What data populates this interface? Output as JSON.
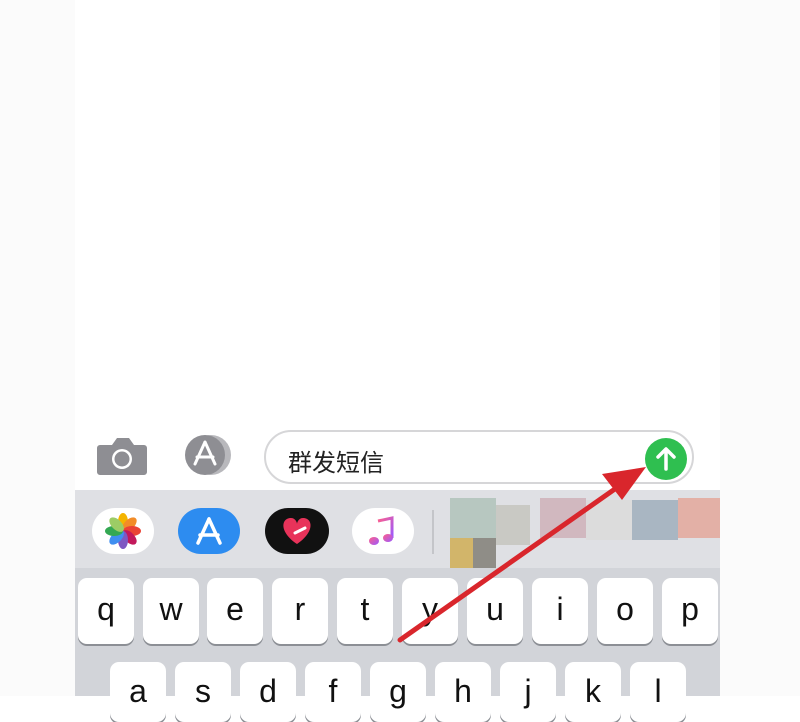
{
  "input_bar": {
    "camera_icon": "camera-icon",
    "apps_icon": "app-store-icon",
    "message_text": "群发短信",
    "send_icon": "arrow-up-icon",
    "send_color": "#2fbf50"
  },
  "app_drawer": {
    "apps": [
      {
        "icon": "photos-icon"
      },
      {
        "icon": "app-store-icon"
      },
      {
        "icon": "digital-touch-heart-icon"
      },
      {
        "icon": "music-icon"
      }
    ]
  },
  "keyboard": {
    "row1": [
      "q",
      "w",
      "e",
      "r",
      "t",
      "y",
      "u",
      "i",
      "o",
      "p"
    ],
    "row2": [
      "a",
      "s",
      "d",
      "f",
      "g",
      "h",
      "j",
      "k",
      "l"
    ]
  },
  "annotation": {
    "arrow_color": "#d9262c"
  }
}
